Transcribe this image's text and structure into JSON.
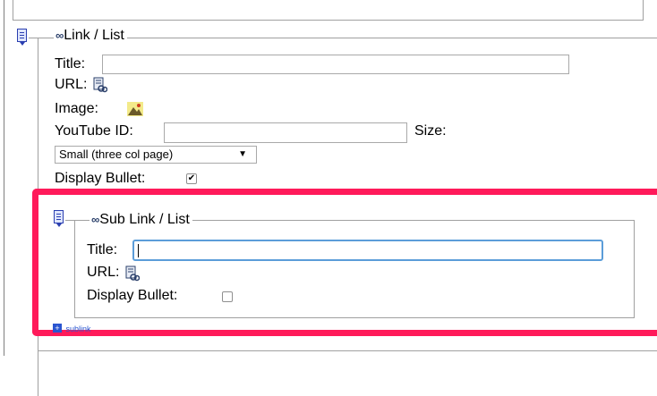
{
  "link_list": {
    "legend": "Link / List",
    "title_label": "Title:",
    "title_value": "",
    "url_label": "URL:",
    "image_label": "Image:",
    "youtube_label": "YouTube ID:",
    "youtube_value": "",
    "size_label": "Size:",
    "size_selected": "Small (three col page)",
    "display_bullet_label": "Display Bullet:",
    "display_bullet_checked": true
  },
  "sub_link_list": {
    "legend": "Sub Link / List",
    "title_label": "Title:",
    "title_value": "",
    "url_label": "URL:",
    "display_bullet_label": "Display Bullet:",
    "display_bullet_checked": false
  },
  "add_sublink_label": "sublink",
  "highlight_color": "#ff1a5a",
  "focus_color": "#5b9dd9",
  "icons": [
    "document-icon",
    "link-icon",
    "page-link-icon",
    "image-icon",
    "checkbox-checked-icon",
    "add-icon"
  ]
}
